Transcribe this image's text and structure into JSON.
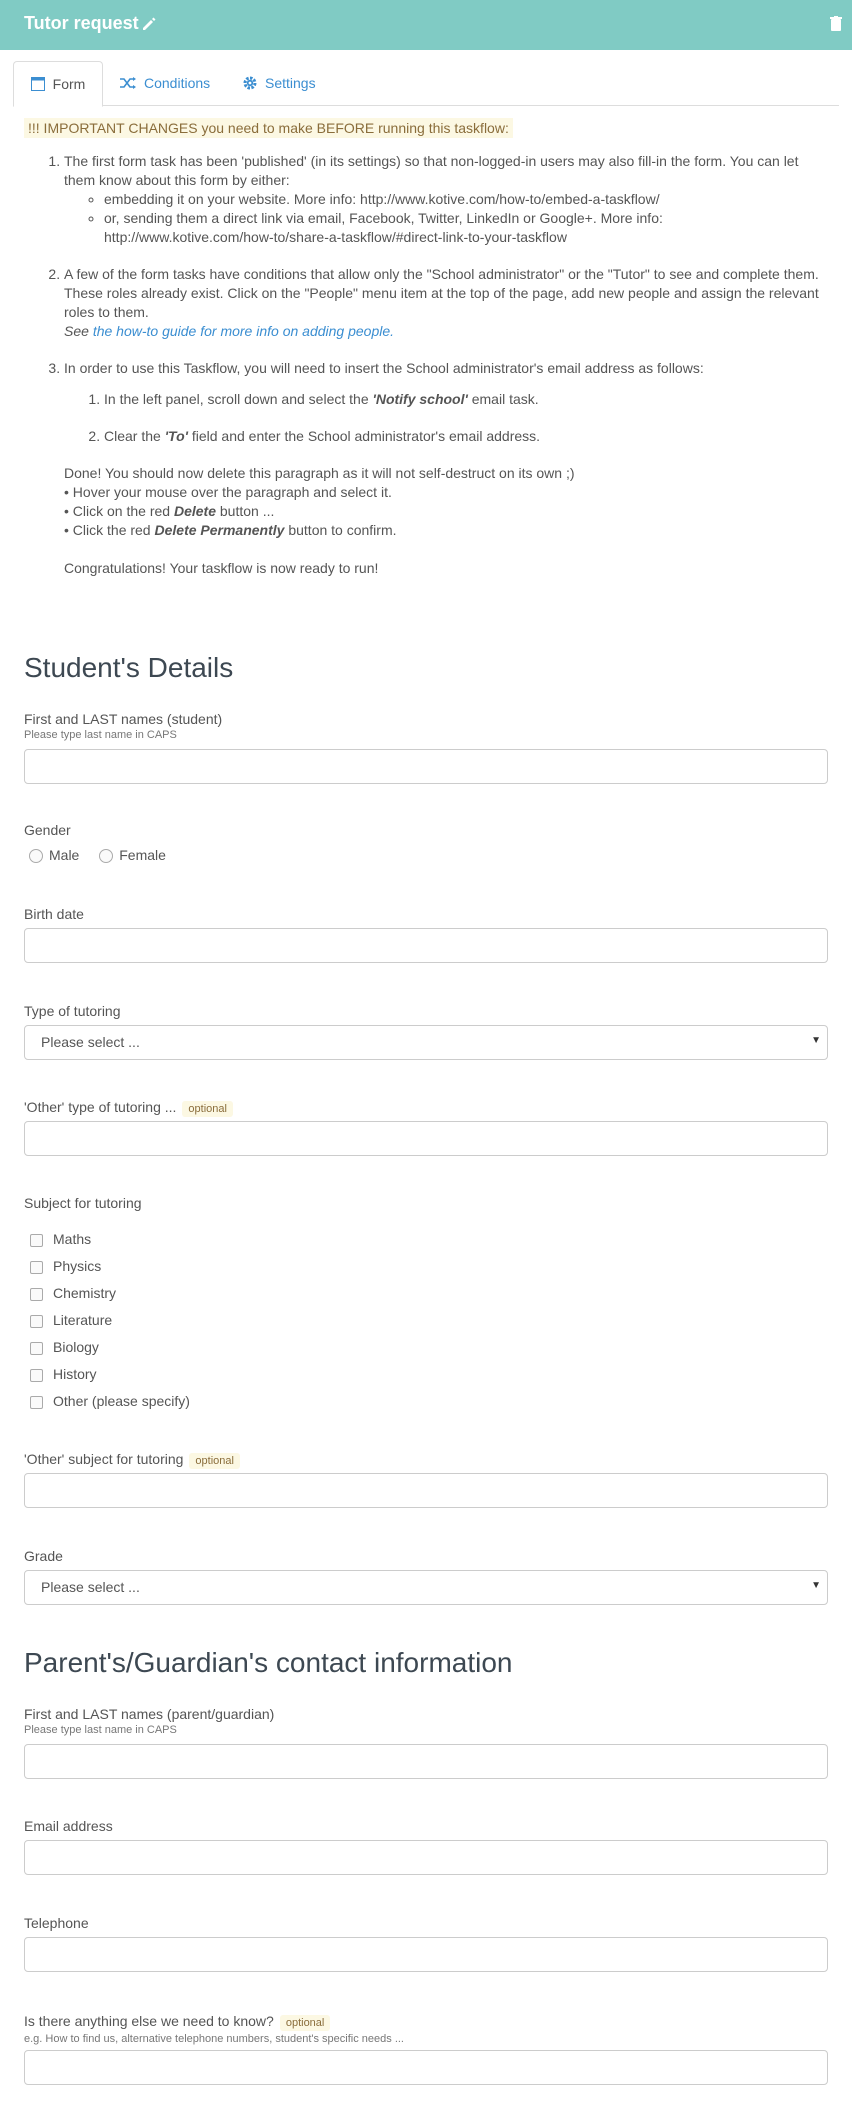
{
  "header": {
    "title": "Tutor request",
    "bg": "#80cbc4"
  },
  "tabs": [
    {
      "label": "Form",
      "icon": "form-icon"
    },
    {
      "label": "Conditions",
      "icon": "shuffle-icon"
    },
    {
      "label": "Settings",
      "icon": "gear-icon"
    }
  ],
  "notice": "!!! IMPORTANT CHANGES you need to make BEFORE running this taskflow:",
  "instructions": {
    "step1": "The first form task has been 'published' (in its settings) so that non-logged-in users may also fill-in the form. You can let them know about this form by either:",
    "step1_a": "embedding it on your website. More info: http://www.kotive.com/how-to/embed-a-taskflow/",
    "step1_b": "or, sending them a direct link via email, Facebook, Twitter, LinkedIn or Google+. More info: http://www.kotive.com/how-to/share-a-taskflow/#direct-link-to-your-taskflow",
    "step2": "A few of the form tasks have conditions that allow only the \"School administrator\" or the \"Tutor\" to see and complete them. These roles already exist. Click on the \"People\" menu item at the top of the page, add new people and assign the relevant roles to them.",
    "step2_see": "See",
    "step2_link": "the how-to guide for more info on adding people",
    "step3": "In order to use this Taskflow, you will need to insert the School administrator's email address as follows:",
    "step3_a_pre": "In the left panel, scroll down and select the",
    "step3_a_bold": "'Notify school'",
    "step3_a_post": "email task.",
    "step3_b_pre": "Clear the",
    "step3_b_bold": "'To'",
    "step3_b_post": "field and enter the School administrator's email address.",
    "done": "Done! You should now delete this paragraph as it will not self-destruct on its own ;)",
    "bullet1": "• Hover your mouse over the paragraph and select it.",
    "bullet2_pre": "• Click on the red",
    "bullet2_bold": "Delete",
    "bullet2_post": "button ...",
    "bullet3_pre": "• Click the red",
    "bullet3_bold": "Delete Permanently",
    "bullet3_post": "button to confirm.",
    "congrats": "Congratulations! Your taskflow is now ready to run!"
  },
  "student": {
    "heading": "Student's Details",
    "name_label": "First and LAST names (student)",
    "name_hint": "Please type last name in CAPS",
    "gender_label": "Gender",
    "gender_male": "Male",
    "gender_female": "Female",
    "birth_label": "Birth date",
    "type_label": "Type of tutoring",
    "type_placeholder": "Please select ...",
    "other_type_label": "'Other' type of tutoring ...",
    "optional": "optional",
    "subject_label": "Subject for tutoring",
    "subjects": [
      "Maths",
      "Physics",
      "Chemistry",
      "Literature",
      "Biology",
      "History",
      "Other (please specify)"
    ],
    "other_subject_label": "'Other' subject for tutoring",
    "grade_label": "Grade",
    "grade_placeholder": "Please select ..."
  },
  "parent": {
    "heading": "Parent's/Guardian's contact information",
    "name_label": "First and LAST names (parent/guardian)",
    "name_hint": "Please type last name in CAPS",
    "email_label": "Email address",
    "phone_label": "Telephone",
    "else_label": "Is there anything else we need to know?",
    "else_hint": "e.g. How to find us, alternative telephone numbers, student's specific needs ..."
  }
}
